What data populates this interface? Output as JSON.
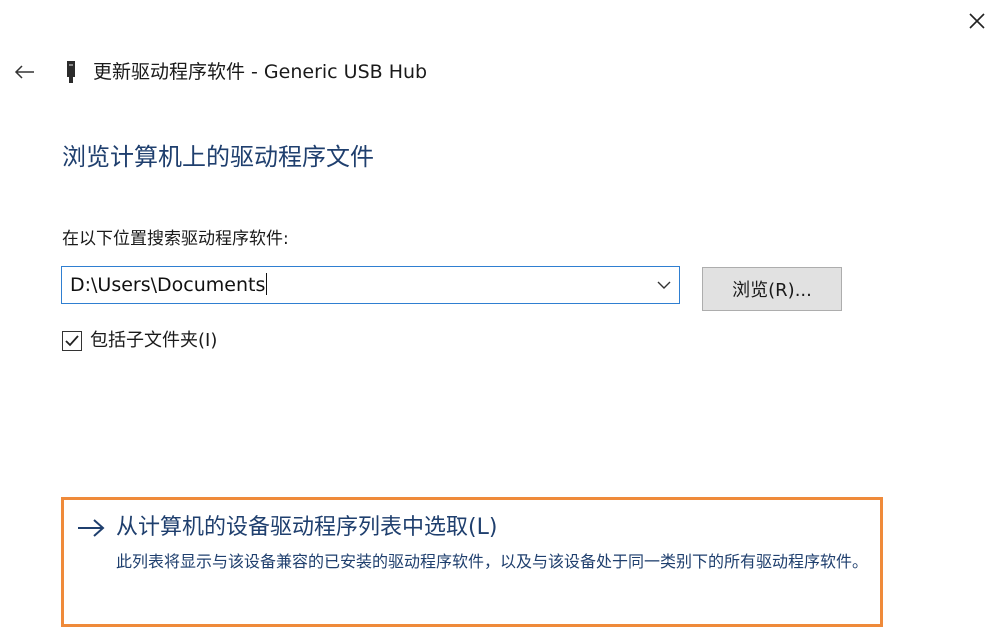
{
  "window": {
    "header_title": "更新驱动程序软件 - Generic USB Hub"
  },
  "icons": {
    "close": "close-icon",
    "back": "back-arrow-icon",
    "device": "usb-device-icon",
    "combo_arrow": "chevron-down-icon",
    "checkbox": "checkmark-icon",
    "option_arrow": "right-arrow-icon"
  },
  "main": {
    "heading": "浏览计算机上的驱动程序文件",
    "search_label": "在以下位置搜索驱动程序软件:",
    "path_value": "D:\\Users\\Documents",
    "browse_label": "浏览(R)...",
    "include_subfolders": {
      "label": "包括子文件夹(I)",
      "checked": true
    }
  },
  "option": {
    "title": "从计算机的设备驱动程序列表中选取(L)",
    "description": "此列表将显示与该设备兼容的已安装的驱动程序软件，以及与该设备处于同一类别下的所有驱动程序软件。"
  },
  "colors": {
    "accent_text": "#1f3f6e",
    "focus_border": "#2f7fd1",
    "highlight_border": "#ef8a3a",
    "button_bg": "#e1e1e1"
  }
}
